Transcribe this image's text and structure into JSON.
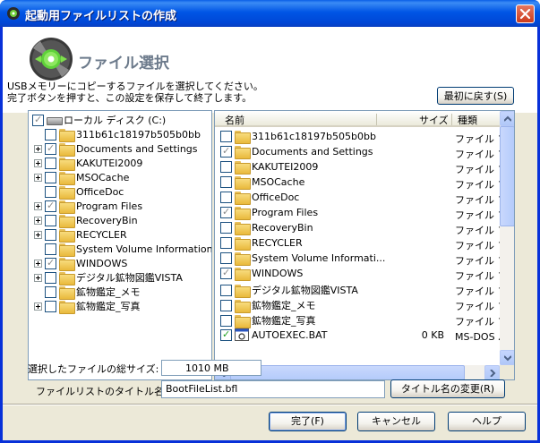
{
  "window": {
    "title": "起動用ファイルリストの作成"
  },
  "header": {
    "heading": "ファイル選択",
    "desc_line1": "USBメモリーにコピーするファイルを選択してください。",
    "desc_line2": "完了ボタンを押すと、この設定を保存して終了します。",
    "reset_button": "最初に戻す(S)"
  },
  "tree": {
    "root": "ローカル ディスク (C:)",
    "items": [
      {
        "label": "311b61c18197b505b0bb",
        "expandable": false,
        "state": "off"
      },
      {
        "label": "Documents and Settings",
        "expandable": true,
        "state": "partial"
      },
      {
        "label": "KAKUTEI2009",
        "expandable": true,
        "state": "off"
      },
      {
        "label": "MSOCache",
        "expandable": true,
        "state": "off"
      },
      {
        "label": "OfficeDoc",
        "expandable": false,
        "state": "off"
      },
      {
        "label": "Program Files",
        "expandable": true,
        "state": "partial"
      },
      {
        "label": "RecoveryBin",
        "expandable": true,
        "state": "off"
      },
      {
        "label": "RECYCLER",
        "expandable": true,
        "state": "off"
      },
      {
        "label": "System Volume Information",
        "expandable": false,
        "state": "off"
      },
      {
        "label": "WINDOWS",
        "expandable": true,
        "state": "partial"
      },
      {
        "label": "デジタル鉱物図鑑VISTA",
        "expandable": true,
        "state": "off"
      },
      {
        "label": "鉱物鑑定_メモ",
        "expandable": false,
        "state": "off"
      },
      {
        "label": "鉱物鑑定_写真",
        "expandable": true,
        "state": "off"
      }
    ]
  },
  "list": {
    "columns": {
      "name": "名前",
      "size": "サイズ",
      "type": "種類"
    },
    "rows": [
      {
        "name": "311b61c18197b505b0bb",
        "size": "",
        "type": "ファイル フォ",
        "state": "off",
        "icon": "folder"
      },
      {
        "name": "Documents and Settings",
        "size": "",
        "type": "ファイル フォ",
        "state": "partial",
        "icon": "folder"
      },
      {
        "name": "KAKUTEI2009",
        "size": "",
        "type": "ファイル フォ",
        "state": "off",
        "icon": "folder"
      },
      {
        "name": "MSOCache",
        "size": "",
        "type": "ファイル フォ",
        "state": "off",
        "icon": "folder"
      },
      {
        "name": "OfficeDoc",
        "size": "",
        "type": "ファイル フォ",
        "state": "off",
        "icon": "folder"
      },
      {
        "name": "Program Files",
        "size": "",
        "type": "ファイル フォ",
        "state": "partial",
        "icon": "folder"
      },
      {
        "name": "RecoveryBin",
        "size": "",
        "type": "ファイル フォ",
        "state": "off",
        "icon": "folder"
      },
      {
        "name": "RECYCLER",
        "size": "",
        "type": "ファイル フォ",
        "state": "off",
        "icon": "folder"
      },
      {
        "name": "System Volume Informati...",
        "size": "",
        "type": "ファイル フォ",
        "state": "off",
        "icon": "folder"
      },
      {
        "name": "WINDOWS",
        "size": "",
        "type": "ファイル フォ",
        "state": "partial",
        "icon": "folder"
      },
      {
        "name": "デジタル鉱物図鑑VISTA",
        "size": "",
        "type": "ファイル フォ",
        "state": "off",
        "icon": "folder"
      },
      {
        "name": "鉱物鑑定_メモ",
        "size": "",
        "type": "ファイル フォ",
        "state": "off",
        "icon": "folder"
      },
      {
        "name": "鉱物鑑定_写真",
        "size": "",
        "type": "ファイル フォ",
        "state": "off",
        "icon": "folder"
      },
      {
        "name": "AUTOEXEC.BAT",
        "size": "0 KB",
        "type": "MS-DOS バ",
        "state": "on",
        "icon": "bat"
      }
    ]
  },
  "footer": {
    "total_size_label": "選択したファイルの総サイズ:",
    "total_size_value": "1010 MB",
    "title_label": "ファイルリストのタイトル名:",
    "title_value": "BootFileList.bfl",
    "rename_button": "タイトル名の変更(R)",
    "ok_button": "完了(F)",
    "cancel_button": "キャンセル",
    "help_button": "ヘルプ"
  }
}
